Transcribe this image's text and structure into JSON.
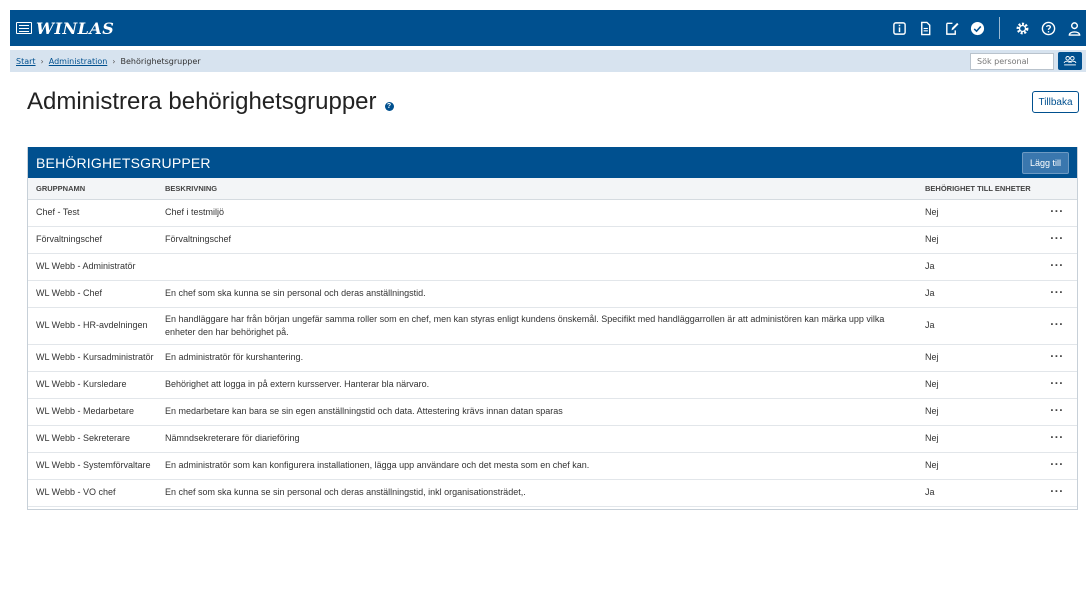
{
  "app": {
    "logo_text": "WINLAS"
  },
  "header": {
    "icons": [
      "info-icon",
      "document-icon",
      "edit-icon",
      "check-circle-icon",
      "gear-icon",
      "help-icon",
      "user-icon"
    ]
  },
  "breadcrumb": {
    "start": "Start",
    "admin": "Administration",
    "current": "Behörighetsgrupper",
    "separator": "›"
  },
  "search": {
    "placeholder": "Sök personal"
  },
  "page": {
    "title": "Administrera behörighetsgrupper",
    "help": "?",
    "back_label": "Tillbaka"
  },
  "panel": {
    "title": "BEHÖRIGHETSGRUPPER",
    "add_label": "Lägg till",
    "columns": [
      "GRUPPNAMN",
      "BESKRIVNING",
      "BEHÖRIGHET TILL ENHETER"
    ],
    "more": "···",
    "rows": [
      {
        "name": "Chef - Test",
        "desc": "Chef i testmiljö",
        "access": "Nej"
      },
      {
        "name": "Förvaltningschef",
        "desc": "Förvaltningschef",
        "access": "Nej"
      },
      {
        "name": "WL Webb - Administratör",
        "desc": "",
        "access": "Ja"
      },
      {
        "name": "WL Webb - Chef",
        "desc": "En chef som ska kunna se sin personal och deras anställningstid.",
        "access": "Ja"
      },
      {
        "name": "WL Webb - HR-avdelningen",
        "desc": "En handläggare har från början ungefär samma roller som en chef, men kan styras enligt kundens önskemål. Specifikt med handläggarrollen är att administören kan märka upp vilka enheter den har behörighet på.",
        "access": "Ja"
      },
      {
        "name": "WL Webb - Kursadministratör",
        "desc": "En administratör för kurshantering.",
        "access": "Nej"
      },
      {
        "name": "WL Webb - Kursledare",
        "desc": "Behörighet att logga in på extern kursserver. Hanterar bla närvaro.",
        "access": "Nej"
      },
      {
        "name": "WL Webb - Medarbetare",
        "desc": "En medarbetare kan bara se sin egen anställningstid och data. Attestering krävs innan datan sparas",
        "access": "Nej"
      },
      {
        "name": "WL Webb - Sekreterare",
        "desc": "Nämndsekreterare för diarieföring",
        "access": "Nej"
      },
      {
        "name": "WL Webb - Systemförvaltare",
        "desc": "En administratör som kan konfigurera installationen, lägga upp användare och det mesta som en chef kan.",
        "access": "Nej"
      },
      {
        "name": "WL Webb - VO chef",
        "desc": "En chef som ska kunna se sin personal och deras anställningstid, inkl organisationsträdet,.",
        "access": "Ja"
      }
    ]
  },
  "colors": {
    "brand": "#00508f",
    "crumb_bg": "#d7e3ef"
  }
}
